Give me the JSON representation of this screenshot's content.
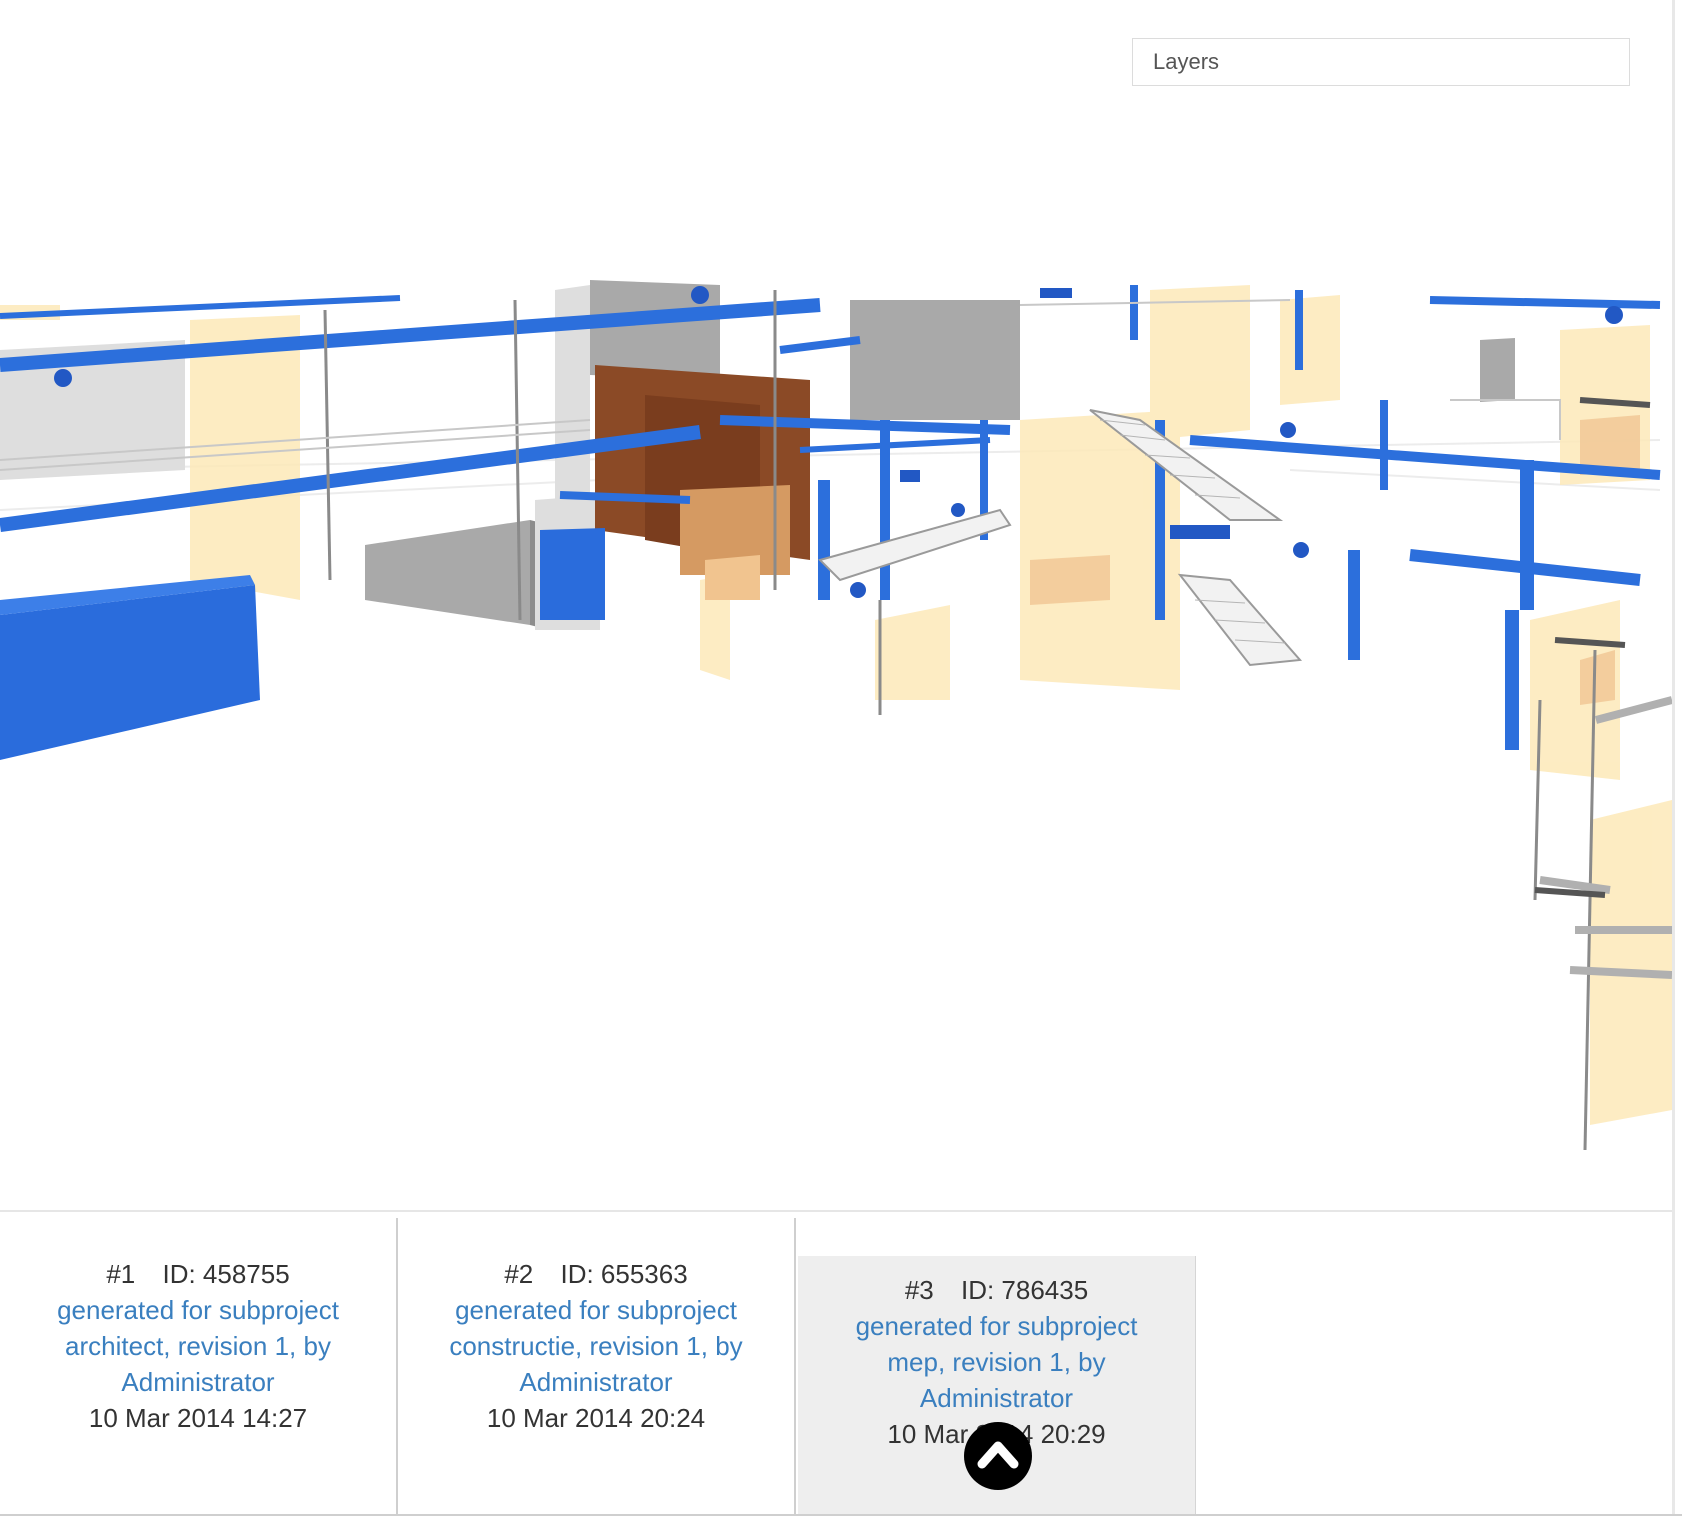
{
  "layers": {
    "label": "Layers"
  },
  "revisions": [
    {
      "number": "#1",
      "id": "ID: 458755",
      "link": "generated for subproject architect, revision 1, by Administrator",
      "date": "10 Mar 2014 14:27"
    },
    {
      "number": "#2",
      "id": "ID: 655363",
      "link": "generated for subproject constructie, revision 1, by Administrator",
      "date": "10 Mar 2014 20:24"
    },
    {
      "number": "#3",
      "id": "ID: 786435",
      "link": "generated for subproject mep, revision 1, by Administrator",
      "date": "10 Mar 2014 20:29"
    }
  ],
  "icons": {
    "scroll_top": "chevron-up-icon"
  },
  "colors": {
    "link": "#3a7fbf",
    "pipe": "#2c6fdc",
    "wall_yellow": "#fde9b8",
    "wood": "#8b4a26",
    "concrete": "#a8a8a8"
  }
}
